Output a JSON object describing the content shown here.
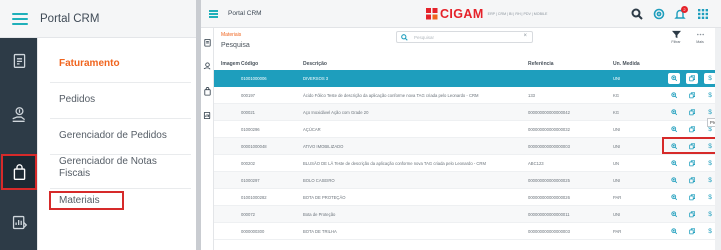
{
  "portal": {
    "title": "Portal CRM",
    "menu": [
      {
        "label": "Faturamento",
        "active": true
      },
      {
        "label": "Pedidos",
        "active": false
      },
      {
        "label": "Gerenciador de Pedidos",
        "active": false
      },
      {
        "label": "Gerenciador de Notas",
        "label2": "Fiscais",
        "active": false
      },
      {
        "label": "Materiais",
        "active": false
      }
    ],
    "rail_icons": [
      "clipboard-icon",
      "money-hand-icon",
      "bag-icon",
      "doc-chart-icon"
    ]
  },
  "app": {
    "title": "Portal CRM",
    "logo_text": "CIGAM",
    "logo_sub": "ERP | CRM | BI | RH | PDV | MOBILE",
    "notification_count": "2",
    "breadcrumb": "Materiais",
    "page_heading": "Pesquisa",
    "search_placeholder": "Pesquisar",
    "search_clear": "×",
    "toolbar": {
      "filter_label": "Filtrar",
      "more_label": "Mais"
    },
    "columns": {
      "image": "Imagem",
      "code": "Código",
      "desc": "Descrição",
      "ref": "Referência",
      "unit": "Un. Medida"
    },
    "tooltip": "Preços",
    "rows": [
      {
        "code": "01001000006",
        "desc": "DIVERSOS 3",
        "ref": "",
        "unit": "UNI"
      },
      {
        "code": "000197",
        "desc": "Ácido Fólico Teste de descrição da aplicação conforme nova TAG criada pelo Leonardo - CRM",
        "ref": "133",
        "unit": "KG"
      },
      {
        "code": "000021",
        "desc": "Aço Inoxidável Ação com Grade 20",
        "ref": "000000000000000042",
        "unit": "KG"
      },
      {
        "code": "01000296",
        "desc": "AÇÚCAR",
        "ref": "000000000000000032",
        "unit": "UNI"
      },
      {
        "code": "00001000048",
        "desc": "ATIVO IMOBILIZADO",
        "ref": "000000000000000003",
        "unit": "UNI"
      },
      {
        "code": "000202",
        "desc": "BLUSÃO DE LÃ Teste de descrição da aplicação conforme nova TAG criada pelo Leonardo - CRM",
        "ref": "ABC123",
        "unit": "UN"
      },
      {
        "code": "01000297",
        "desc": "BOLO CASEIRO",
        "ref": "000000000000000025",
        "unit": "UNI"
      },
      {
        "code": "01001000282",
        "desc": "BOTA DE PROTEÇÃO",
        "ref": "000000000000000026",
        "unit": "PAR"
      },
      {
        "code": "000072",
        "desc": "Bota de Proteção",
        "ref": "000000000000000011",
        "unit": "UNI"
      },
      {
        "code": "0000000300",
        "desc": "BOTA DE TRILHA",
        "ref": "000000000000000003",
        "unit": "PAR"
      }
    ],
    "row_action_price_label": "$"
  },
  "colors": {
    "accent": "#1e9ebd",
    "orange": "#f0651f",
    "highlight": "#d62a2a",
    "rail": "#2d3b47"
  }
}
